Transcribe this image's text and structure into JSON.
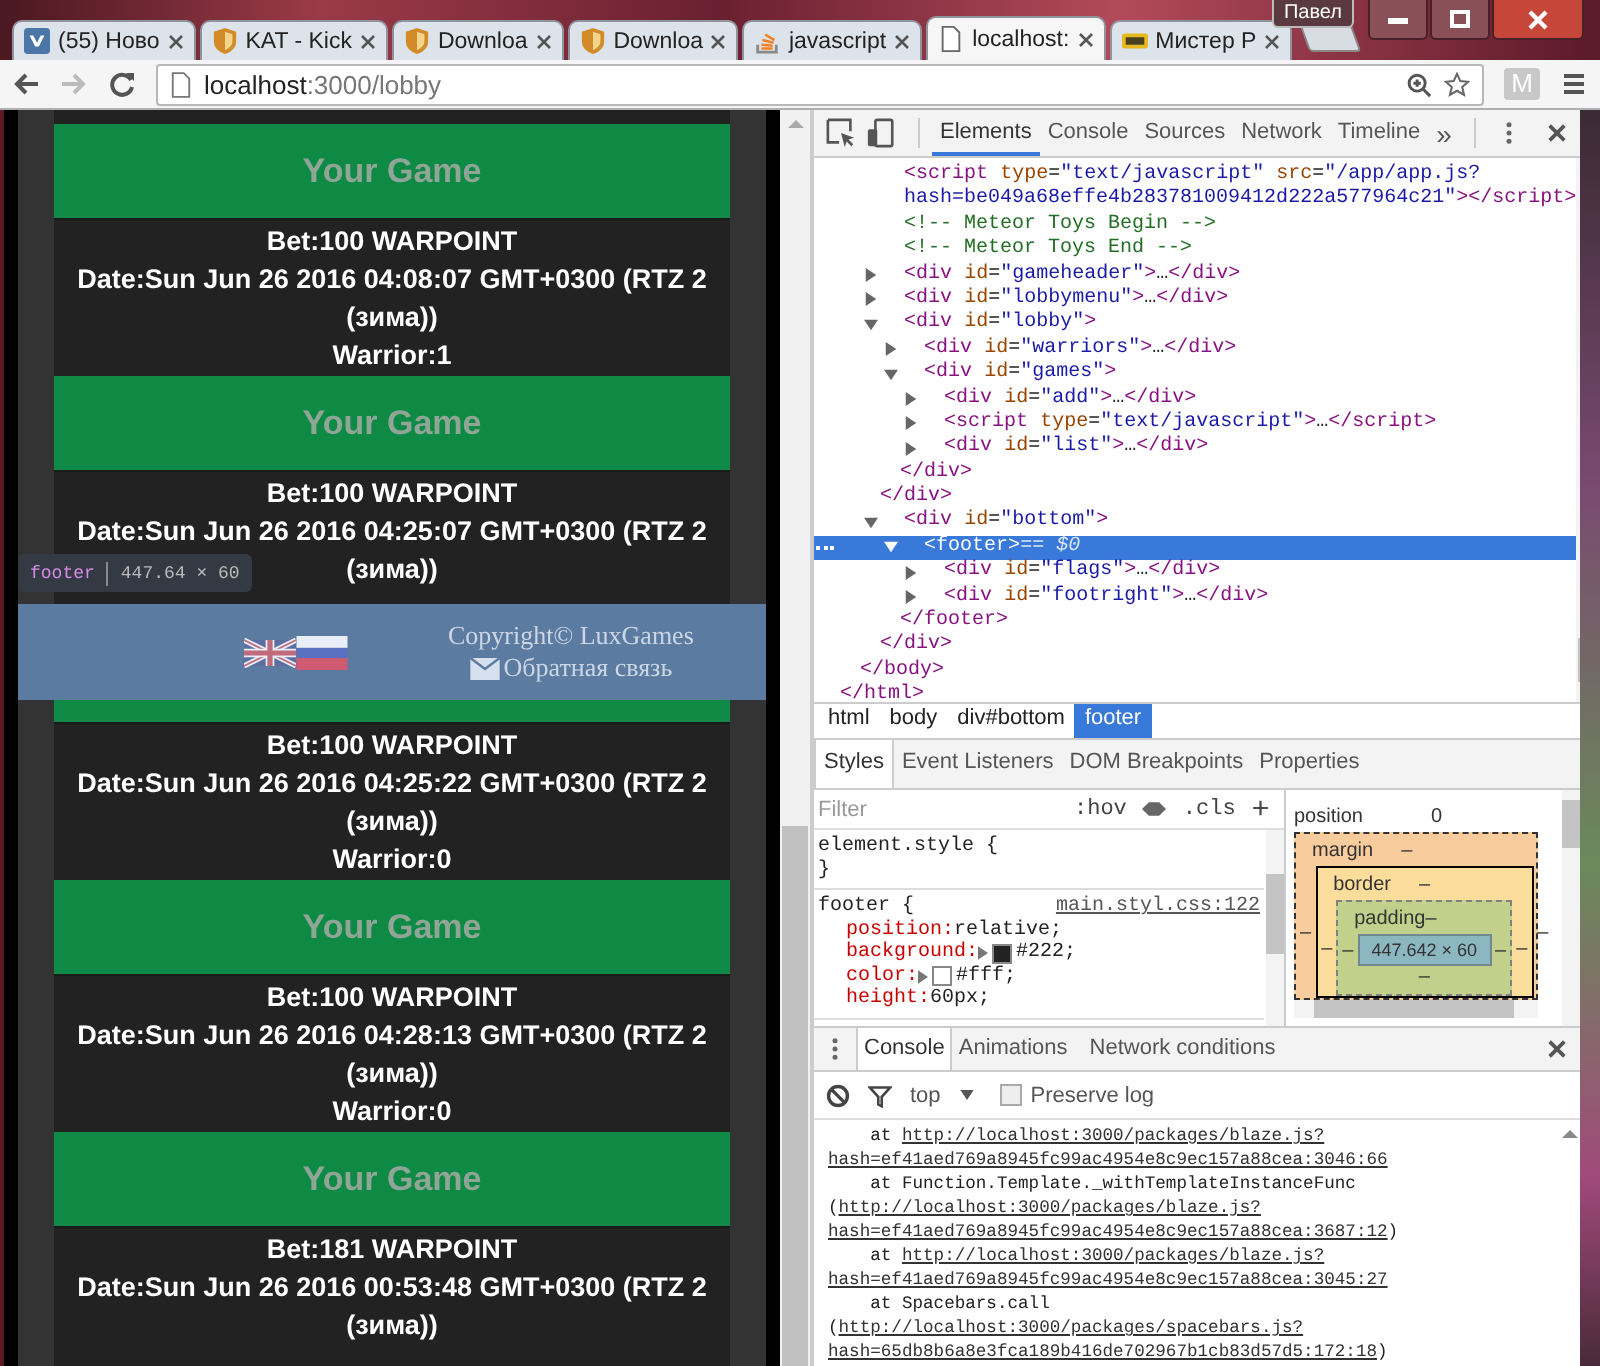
{
  "browser": {
    "tabs": [
      {
        "label": "(55) Ново",
        "kind": "square",
        "selected": false
      },
      {
        "label": "KAT - Kick",
        "kind": "shield",
        "selected": false
      },
      {
        "label": "Downloa",
        "kind": "shield",
        "selected": false
      },
      {
        "label": "Downloa",
        "kind": "shield",
        "selected": false
      },
      {
        "label": "javascript",
        "kind": "stack",
        "selected": false
      },
      {
        "label": "localhost:",
        "kind": "page",
        "selected": true
      },
      {
        "label": "Мистер Р",
        "kind": "badge",
        "selected": false
      }
    ],
    "profile": "Павел",
    "url_host": "localhost",
    "url_path": ":3000/lobby",
    "extension": "M"
  },
  "page": {
    "games": [
      {
        "button": "Your Game",
        "bet": "Bet:100 WARPOINT",
        "date_lines": [
          "Date:Sun Jun 26 2016 04:08:07 GMT+0300 (RTZ 2",
          "(зима))"
        ],
        "warrior": "Warrior:1"
      },
      {
        "button": "Your Game",
        "bet": "Bet:100 WARPOINT",
        "date_lines": [
          "Date:Sun Jun 26 2016 04:25:07 GMT+0300 (RTZ 2",
          "(зима))"
        ]
      },
      {
        "bet": "Bet:100 WARPOINT",
        "date_lines": [
          "Date:Sun Jun 26 2016 04:25:22 GMT+0300 (RTZ 2",
          "(зима))"
        ],
        "warrior": "Warrior:0"
      },
      {
        "button": "Your Game",
        "bet": "Bet:100 WARPOINT",
        "date_lines": [
          "Date:Sun Jun 26 2016 04:28:13 GMT+0300 (RTZ 2",
          "(зима))"
        ],
        "warrior": "Warrior:0"
      },
      {
        "button": "Your Game",
        "bet": "Bet:181 WARPOINT",
        "date_lines": [
          "Date:Sun Jun 26 2016 00:53:48 GMT+0300 (RTZ 2",
          "(зима))"
        ]
      }
    ],
    "footer": {
      "copyright": "Copyright© LuxGames",
      "feedback": "Обратная связь"
    },
    "inspect_tooltip": {
      "tag": "footer",
      "size": "447.64 × 60"
    }
  },
  "devtools": {
    "tabs": [
      {
        "label": "Elements",
        "selected": true
      },
      {
        "label": "Console",
        "selected": false
      },
      {
        "label": "Sources",
        "selected": false
      },
      {
        "label": "Network",
        "selected": false
      },
      {
        "label": "Timeline",
        "selected": false
      }
    ],
    "more": "»",
    "dom": [
      {
        "close": "</html>",
        "children": [
          {
            "close": "</body>",
            "children": [
              {
                "kind": "tag",
                "selected": false,
                "lines": [
                  "<script type=\"text/javascript\" src=\"/app/app.js?",
                  "hash=be049a68effe4b283781009412d222a577964c21\"></script>"
                ]
              },
              {
                "kind": "comment",
                "selected": false,
                "lines": [
                  "<!-- Meteor Toys Begin -->"
                ]
              },
              {
                "kind": "comment",
                "selected": false,
                "lines": [
                  "<!-- Meteor Toys End -->"
                ]
              },
              {
                "kind": "tag",
                "selected": false,
                "expanded": false,
                "lines": [
                  "<div id=\"gameheader\">…</div>"
                ]
              },
              {
                "kind": "tag",
                "selected": false,
                "expanded": false,
                "lines": [
                  "<div id=\"lobbymenu\">…</div>"
                ]
              },
              {
                "kind": "tag",
                "selected": false,
                "expanded": true,
                "lines": [
                  "<div id=\"lobby\">"
                ],
                "close": "</div>",
                "children": [
                  {
                    "kind": "tag",
                    "selected": false,
                    "expanded": false,
                    "lines": [
                      "<div id=\"warriors\">…</div>"
                    ]
                  },
                  {
                    "kind": "tag",
                    "selected": false,
                    "expanded": true,
                    "lines": [
                      "<div id=\"games\">"
                    ],
                    "close": "</div>",
                    "children": [
                      {
                        "kind": "tag",
                        "selected": false,
                        "expanded": false,
                        "lines": [
                          "<div id=\"add\">…</div>"
                        ]
                      },
                      {
                        "kind": "tag",
                        "selected": false,
                        "expanded": false,
                        "lines": [
                          "<script type=\"text/javascript\">…</script>"
                        ]
                      },
                      {
                        "kind": "tag",
                        "selected": false,
                        "expanded": false,
                        "lines": [
                          "<div id=\"list\">…</div>"
                        ]
                      }
                    ]
                  }
                ]
              },
              {
                "kind": "tag",
                "selected": false,
                "expanded": true,
                "lines": [
                  "<div id=\"bottom\">"
                ],
                "close": "</div>",
                "children": [
                  {
                    "kind": "tag",
                    "selected": true,
                    "expanded": true,
                    "lines": [
                      "<footer>"
                    ],
                    "marker": "== $0",
                    "close": "</footer>",
                    "children": [
                      {
                        "kind": "tag",
                        "selected": false,
                        "expanded": false,
                        "lines": [
                          "<div id=\"flags\">…</div>"
                        ]
                      },
                      {
                        "kind": "tag",
                        "selected": false,
                        "expanded": false,
                        "lines": [
                          "<div id=\"footright\">…</div>"
                        ]
                      }
                    ]
                  }
                ]
              }
            ]
          }
        ]
      }
    ],
    "breadcrumbs": [
      {
        "label": "html",
        "selected": false
      },
      {
        "label": "body",
        "selected": false
      },
      {
        "label": "div#bottom",
        "selected": false
      },
      {
        "label": "footer",
        "selected": true
      }
    ],
    "styles_tabs": [
      {
        "label": "Styles",
        "selected": true
      },
      {
        "label": "Event Listeners",
        "selected": false
      },
      {
        "label": "DOM Breakpoints",
        "selected": false
      },
      {
        "label": "Properties",
        "selected": false
      }
    ],
    "filter_placeholder": "Filter",
    "hov": ":hov",
    "cls": ".cls",
    "add": "+",
    "rules": [
      {
        "selector": "element.style {",
        "close": "}"
      },
      {
        "selector": "footer {",
        "source": "main.styl.css:122",
        "props": [
          {
            "name": "position:",
            "value": "relative;"
          },
          {
            "name": "background:",
            "value": "#222;",
            "color": "#222222"
          },
          {
            "name": "color:",
            "value": "#fff;",
            "color": "#ffffff"
          },
          {
            "name": "height:",
            "value": "60px;"
          }
        ]
      }
    ],
    "box_model": {
      "position_label": "position",
      "position_value": "0",
      "margin": {
        "label": "margin",
        "top": "–",
        "left": "–",
        "right": "–"
      },
      "border": {
        "label": "border",
        "top": "–",
        "left": "–",
        "right": "–"
      },
      "padding": {
        "label": "padding",
        "top": "–",
        "left": "–",
        "right": "–",
        "bottom": "–"
      },
      "content": "447.642 × 60"
    },
    "drawer_tabs": [
      {
        "label": "Console",
        "selected": true
      },
      {
        "label": "Animations",
        "selected": false
      },
      {
        "label": "Network conditions",
        "selected": false
      }
    ],
    "context": "top",
    "preserve_log": {
      "label": "Preserve log",
      "checked": false
    },
    "console": [
      {
        "parts": [
          {
            "text": "    at ",
            "link": false
          },
          {
            "text": "http://localhost:3000/packages/blaze.js?",
            "link": true
          }
        ]
      },
      {
        "parts": [
          {
            "text": "hash=ef41aed769a8945fc99ac4954e8c9ec157a88cea:3046:66",
            "link": true
          }
        ]
      },
      {
        "parts": [
          {
            "text": "    at Function.Template._withTemplateInstanceFunc",
            "link": false
          }
        ]
      },
      {
        "parts": [
          {
            "text": "(",
            "link": false
          },
          {
            "text": "http://localhost:3000/packages/blaze.js?",
            "link": true
          }
        ]
      },
      {
        "parts": [
          {
            "text": "hash=ef41aed769a8945fc99ac4954e8c9ec157a88cea:3687:12",
            "link": true
          },
          {
            "text": ")",
            "link": false
          }
        ]
      },
      {
        "parts": [
          {
            "text": "    at ",
            "link": false
          },
          {
            "text": "http://localhost:3000/packages/blaze.js?",
            "link": true
          }
        ]
      },
      {
        "parts": [
          {
            "text": "hash=ef41aed769a8945fc99ac4954e8c9ec157a88cea:3045:27",
            "link": true
          }
        ]
      },
      {
        "parts": [
          {
            "text": "    at Spacebars.call",
            "link": false
          }
        ]
      },
      {
        "parts": [
          {
            "text": "(",
            "link": false
          },
          {
            "text": "http://localhost:3000/packages/spacebars.js?",
            "link": true
          }
        ]
      },
      {
        "parts": [
          {
            "text": "hash=65db8b6a8e3fca189b416de702967b1cb83d57d5:172:18",
            "link": true
          },
          {
            "text": ")",
            "link": false
          }
        ]
      }
    ]
  }
}
